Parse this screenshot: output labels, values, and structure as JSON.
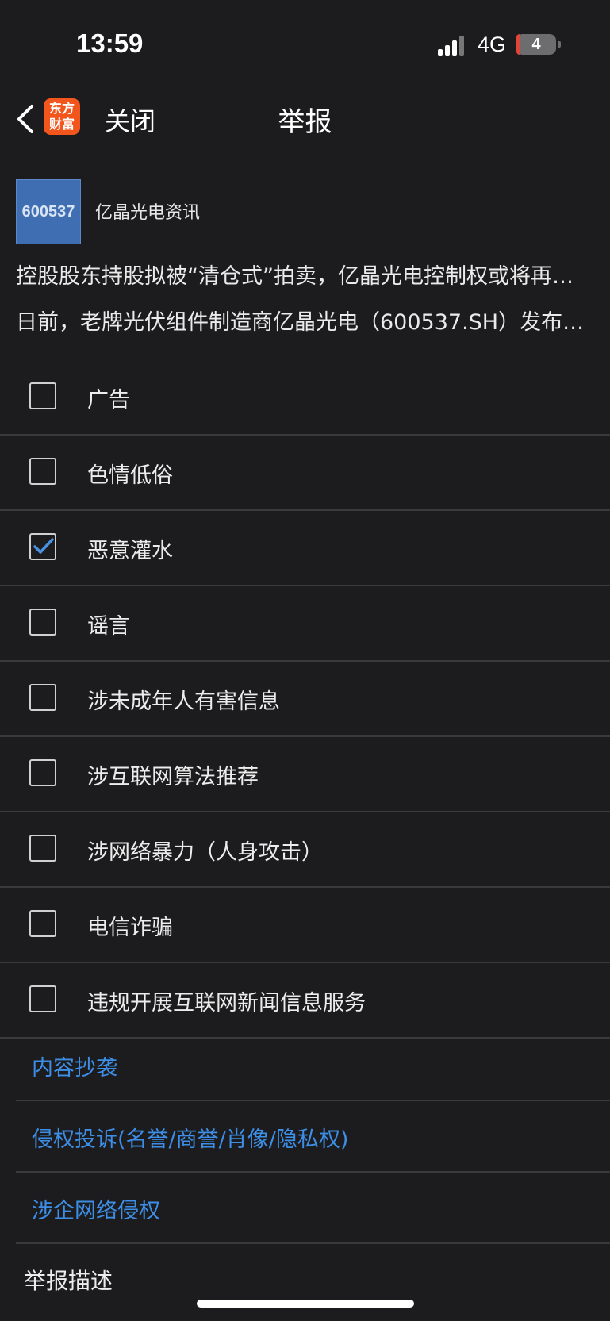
{
  "status_bar": {
    "time": "13:59",
    "network": "4G",
    "battery": "4"
  },
  "nav": {
    "logo_line1": "东方",
    "logo_line2": "财富",
    "close_label": "关闭",
    "title": "举报"
  },
  "article": {
    "thumbnail_text": "600537",
    "source": "亿晶光电资讯",
    "headline": "控股股东持股拟被“清仓式”拍卖，亿晶光电控制权或将再…",
    "summary": "日前，老牌光伏组件制造商亿晶光电（600537.SH）发布…"
  },
  "options": [
    {
      "label": "广告",
      "checked": false
    },
    {
      "label": "色情低俗",
      "checked": false
    },
    {
      "label": "恶意灌水",
      "checked": true
    },
    {
      "label": "谣言",
      "checked": false
    },
    {
      "label": "涉未成年人有害信息",
      "checked": false
    },
    {
      "label": "涉互联网算法推荐",
      "checked": false
    },
    {
      "label": "涉网络暴力（人身攻击）",
      "checked": false
    },
    {
      "label": "电信诈骗",
      "checked": false
    },
    {
      "label": "违规开展互联网新闻信息服务",
      "checked": false
    }
  ],
  "links": [
    {
      "label": "内容抄袭"
    },
    {
      "label": "侵权投诉(名誉/商誉/肖像/隐私权)"
    },
    {
      "label": "涉企网络侵权"
    }
  ],
  "description_label": "举报描述",
  "colors": {
    "background": "#1c1c1e",
    "divider": "#3a3a3c",
    "link_blue": "#3d8ee6",
    "check_blue": "#4a90e2",
    "logo_orange": "#f2561d"
  }
}
